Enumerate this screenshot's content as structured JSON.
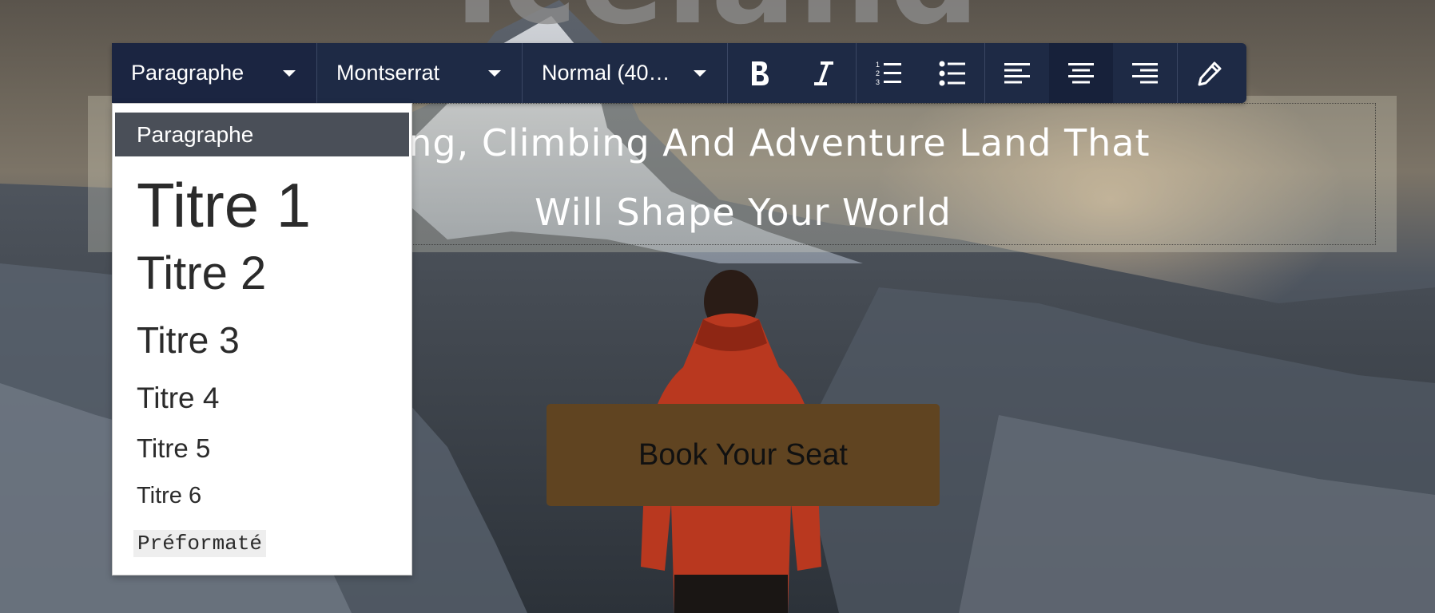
{
  "page": {
    "hero_title": "Iceland",
    "tagline_line1": "Hiking, Climbing And Adventure Land That",
    "tagline_line2": "Will Shape Your World",
    "cta_label": "Book Your Seat"
  },
  "toolbar": {
    "block_format": "Paragraphe",
    "font_family": "Montserrat",
    "font_weight": "Normal (40…",
    "buttons": [
      {
        "name": "bold",
        "icon": "bold-icon"
      },
      {
        "name": "italic",
        "icon": "italic-icon"
      },
      {
        "name": "ordered-list",
        "icon": "ordered-list-icon"
      },
      {
        "name": "unordered-list",
        "icon": "unordered-list-icon"
      },
      {
        "name": "align-left",
        "icon": "align-left-icon"
      },
      {
        "name": "align-center",
        "icon": "align-center-icon",
        "active": true
      },
      {
        "name": "align-right",
        "icon": "align-right-icon"
      },
      {
        "name": "edit",
        "icon": "pencil-icon"
      }
    ]
  },
  "block_format_menu": {
    "selected": "Paragraphe",
    "options": [
      "Paragraphe",
      "Titre 1",
      "Titre 2",
      "Titre 3",
      "Titre 4",
      "Titre 5",
      "Titre 6",
      "Préformaté"
    ]
  },
  "colors": {
    "toolbar_bg": "#1e2a45",
    "cta_bg": "#604421",
    "menu_selected_bg": "#4a4f58"
  }
}
